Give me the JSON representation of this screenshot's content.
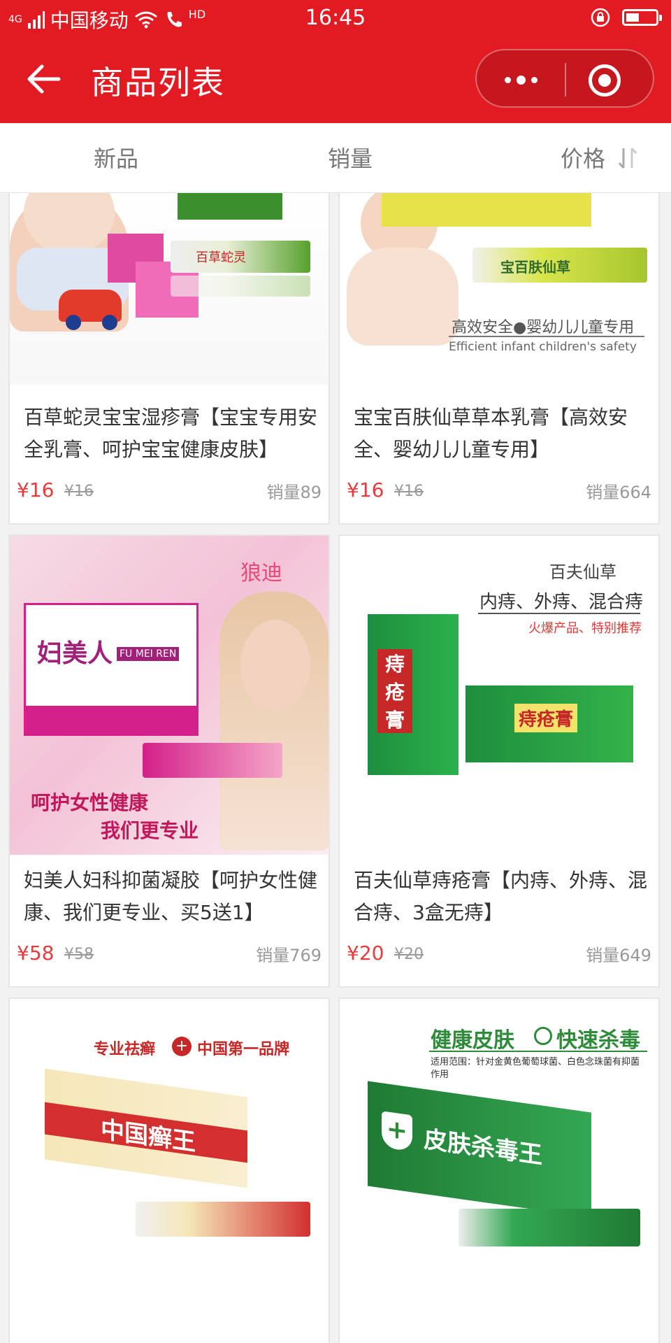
{
  "status_bar": {
    "carrier": "中国移动",
    "network": "4G",
    "hd": "HD",
    "time": "16:45"
  },
  "nav": {
    "title": "商品列表"
  },
  "sort": {
    "new": "新品",
    "sales": "销量",
    "price": "价格"
  },
  "products": [
    {
      "name": "百草蛇灵宝宝湿疹膏【宝宝专用安全乳膏、呵护宝宝健康皮肤】",
      "price": "¥16",
      "original_price": "¥16",
      "sales": "销量89",
      "image_text": [
        "百草蛇灵"
      ]
    },
    {
      "name": "宝宝百肤仙草草本乳膏【高效安全、婴幼儿儿童专用】",
      "price": "¥16",
      "original_price": "¥16",
      "sales": "销量664",
      "image_text": [
        "高效安全●婴幼儿儿童专用",
        "Efficient infant children's safety",
        "宝百肤仙草"
      ]
    },
    {
      "name": "妇美人妇科抑菌凝胶【呵护女性健康、我们更专业、买5送1】",
      "price": "¥58",
      "original_price": "¥58",
      "sales": "销量769",
      "image_text": [
        "狼迪",
        "妇美人",
        "FU MEI REN",
        "呵护女性健康",
        "我们更专业"
      ]
    },
    {
      "name": "百夫仙草痔疮膏【内痔、外痔、混合痔、3盒无痔】",
      "price": "¥20",
      "original_price": "¥20",
      "sales": "销量649",
      "image_text": [
        "百夫仙草",
        "内痔、外痔、混合痔",
        "火爆产品、特别推荐",
        "痔疮膏"
      ]
    },
    {
      "name": "",
      "price": "",
      "original_price": "",
      "sales": "",
      "image_text": [
        "专业祛癣",
        "中国第一品牌",
        "中国癣王"
      ]
    },
    {
      "name": "",
      "price": "",
      "original_price": "",
      "sales": "",
      "image_text": [
        "健康皮肤",
        "快速杀毒",
        "适用范围：针对金黄色葡萄球菌、白色念珠菌有抑菌作用",
        "皮肤杀毒王"
      ]
    }
  ],
  "colors": {
    "brand_red": "#e21b23",
    "price_red": "#e83c3c",
    "muted": "#999999"
  }
}
